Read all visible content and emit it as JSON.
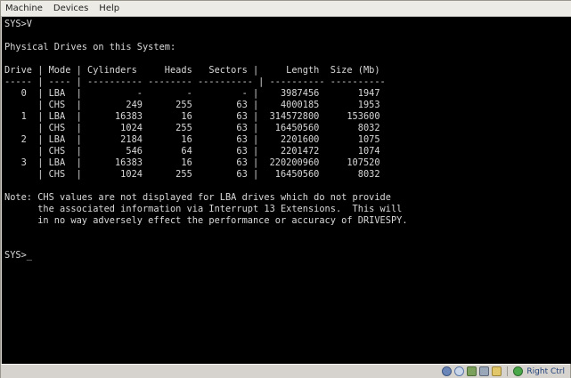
{
  "menu": {
    "items": [
      "Machine",
      "Devices",
      "Help"
    ]
  },
  "terminal": {
    "lines": [
      "SYS>V",
      "",
      "Physical Drives on this System:",
      "",
      "Drive | Mode | Cylinders     Heads   Sectors |     Length  Size (Mb)",
      "----- | ---- | ---------- -------- ---------- | ---------- ----------",
      "   0  | LBA  |          -        -         - |    3987456       1947",
      "      | CHS  |        249      255        63 |    4000185       1953",
      "   1  | LBA  |      16383       16        63 |  314572800     153600",
      "      | CHS  |       1024      255        63 |   16450560       8032",
      "   2  | LBA  |       2184       16        63 |    2201600       1075",
      "      | CHS  |        546       64        63 |    2201472       1074",
      "   3  | LBA  |      16383       16        63 |  220200960     107520",
      "      | CHS  |       1024      255        63 |   16450560       8032",
      "",
      "Note: CHS values are not displayed for LBA drives which do not provide",
      "      the associated information via Interrupt 13 Extensions.  This will",
      "      in no way adversely effect the performance or accuracy of DRIVESPY.",
      "",
      "",
      "SYS>_"
    ]
  },
  "statusbar": {
    "host_key": "Right Ctrl",
    "icons": [
      "hdd-icon",
      "cd-icon",
      "network-icon",
      "usb-icon",
      "shared-folder-icon",
      "mouse-integration-icon"
    ]
  },
  "colors": {
    "terminal_bg": "#000000",
    "terminal_fg": "#d8d8d8",
    "chrome": "#d6d3ce"
  }
}
